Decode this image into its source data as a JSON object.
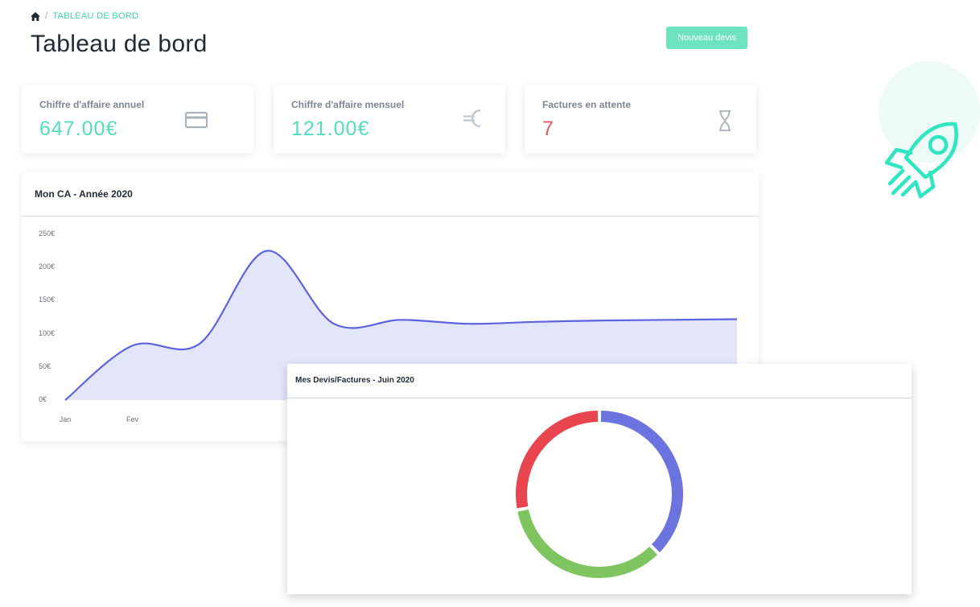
{
  "breadcrumb": {
    "home_icon": "home-icon",
    "separator": "/",
    "current": "TABLEAU DE BORD"
  },
  "page": {
    "title": "Tableau de bord",
    "new_quote_button": "Nouveau devis"
  },
  "stats": [
    {
      "label": "Chiffre d'affaire annuel",
      "value": "647.00€",
      "icon": "credit-card-icon",
      "color": "#54dcc0"
    },
    {
      "label": "Chiffre d'affaire mensuel",
      "value": "121.00€",
      "icon": "euro-icon",
      "color": "#54dcc0"
    },
    {
      "label": "Factures en attente",
      "value": "7",
      "icon": "hourglass-icon",
      "color": "#e55a63"
    }
  ],
  "revenue_chart": {
    "title": "Mon CA - Année 2020"
  },
  "quotes_chart": {
    "title": "Mes Devis/Factures - Juin 2020"
  },
  "decoration": {
    "icon": "rocket-icon",
    "color": "#2ee6c0"
  },
  "chart_data": [
    {
      "type": "area",
      "title": "Mon CA - Année 2020",
      "x_tick_labels": [
        "Jan",
        "Fev"
      ],
      "y_ticks": [
        "0€",
        "50€",
        "100€",
        "150€",
        "200€",
        "250€"
      ],
      "ylim": [
        0,
        250
      ],
      "series": [
        {
          "color": "#5b63e0",
          "fill": "#e3e6f8",
          "x": [
            0,
            1,
            2,
            3,
            4,
            5,
            6,
            7,
            8,
            9,
            10
          ],
          "values": [
            0,
            82,
            85,
            225,
            115,
            121,
            115,
            118,
            120,
            121,
            122
          ]
        }
      ],
      "grid": false
    },
    {
      "type": "pie",
      "subtype": "donut",
      "title": "Mes Devis/Factures - Juin 2020",
      "slices": [
        {
          "value": 37.5,
          "color": "#6b73df"
        },
        {
          "value": 34.5,
          "color": "#7ec45f"
        },
        {
          "value": 28,
          "color": "#e8454f"
        }
      ]
    }
  ]
}
